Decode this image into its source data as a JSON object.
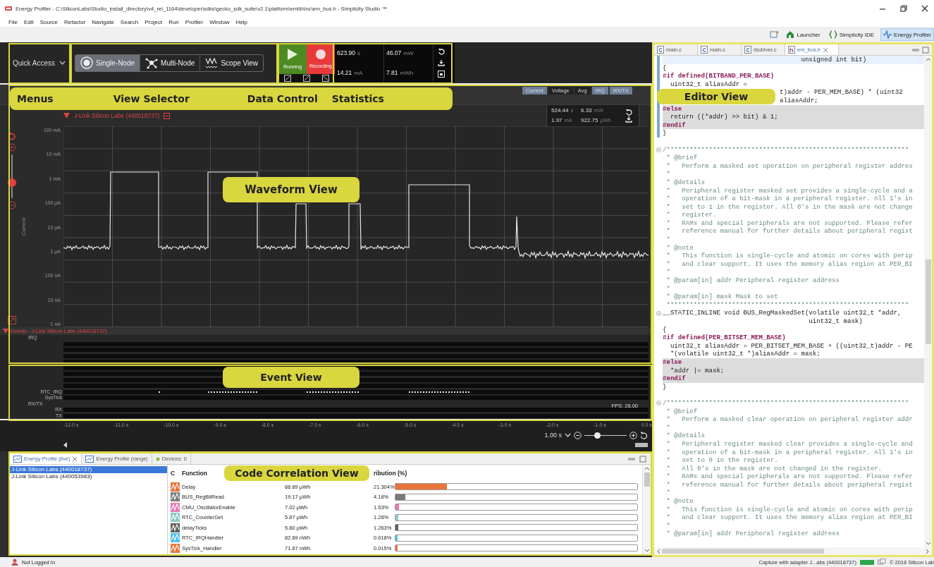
{
  "window": {
    "title": "Energy Profiler - C:\\SiliconLabs\\Studio_install_directory\\v4_rel_1164\\developer\\sdks\\gecko_sdk_suite\\v2.1\\platform\\emlib\\inc\\em_bus.h - Simplicity Studio ™"
  },
  "menu": [
    "File",
    "Edit",
    "Source",
    "Refactor",
    "Navigate",
    "Search",
    "Project",
    "Run",
    "Profiler",
    "Window",
    "Help"
  ],
  "perspectives": [
    {
      "label": "Launcher",
      "kind": "home",
      "selected": false
    },
    {
      "label": "Simplicity IDE",
      "kind": "braces",
      "selected": false
    },
    {
      "label": "Energy Profiler",
      "kind": "pulse",
      "selected": true
    }
  ],
  "toolbar": {
    "quick_access": "Quick Access",
    "views": [
      {
        "label": "Single-Node",
        "kind": "single",
        "selected": true
      },
      {
        "label": "Multi-Node",
        "kind": "multi",
        "selected": false
      },
      {
        "label": "Scope View",
        "kind": "scope",
        "selected": false
      }
    ],
    "controls": [
      {
        "label": "Running",
        "kind": "play"
      },
      {
        "label": "Recording",
        "kind": "record"
      }
    ],
    "statistics": [
      {
        "value": "623.90",
        "unit": "s"
      },
      {
        "value": "46.07",
        "unit": "mW"
      },
      {
        "value": "14.21",
        "unit": "mA"
      },
      {
        "value": "7.81",
        "unit": "mWh"
      }
    ]
  },
  "annotations": {
    "top": [
      "Menus",
      "View Selector",
      "Data Control",
      "Statistics"
    ],
    "waveform": "Waveform View",
    "events": "Event View",
    "code": "Code Correlation View",
    "editor": "Editor View"
  },
  "waveform": {
    "toggles": [
      {
        "label": "Current",
        "on": true
      },
      {
        "label": "Voltage",
        "on": false
      },
      {
        "label": "Avg",
        "on": false
      },
      {
        "label": "IRQ",
        "on": true
      },
      {
        "label": "RX/TX",
        "on": true
      }
    ],
    "device": "J-Link Silicon Labs (440018737)",
    "stats": [
      {
        "value": "524.44",
        "unit": "s"
      },
      {
        "value": "6.33",
        "unit": "mW"
      },
      {
        "value": "1.97",
        "unit": "mA"
      },
      {
        "value": "922.75",
        "unit": "µWh"
      }
    ],
    "y_axis_title": "Current",
    "y_ticks": [
      "100 mA",
      "10 mA",
      "1 mA",
      "100 µA",
      "10 µA",
      "1 µA",
      "100 nA",
      "10 nA",
      "1 nA"
    ],
    "zoom_slider": {
      "level": 0.35
    }
  },
  "events": {
    "title": "Events - J-Link Silicon Labs (440018737)",
    "rows": [
      {
        "label": "IRQ",
        "kind": "group"
      },
      {
        "kind": "track"
      },
      {
        "kind": "track"
      },
      {
        "kind": "track"
      },
      {
        "kind": "track"
      },
      {
        "kind": "track"
      },
      {
        "kind": "track"
      },
      {
        "kind": "track"
      },
      {
        "kind": "track"
      },
      {
        "label": "RTC_IRQ",
        "kind": "track"
      },
      {
        "label": "SysTick",
        "kind": "track"
      },
      {
        "label": "RX/TX",
        "kind": "group"
      },
      {
        "label": "RX",
        "kind": "track"
      },
      {
        "label": "TX",
        "kind": "track"
      }
    ],
    "fps": "FPS: 28.00"
  },
  "timeline": {
    "ticks": [
      "-12.0 s",
      "-11.0 s",
      "-10.0 s",
      "-9.0 s",
      "-8.0 s",
      "-7.0 s",
      "-6.0 s",
      "-5.0 s",
      "-4.0 s",
      "-3.0 s",
      "-2.0 s",
      "-1.0 s",
      "0.0 s"
    ],
    "zoom": "1.00 s",
    "zoom_slider": {
      "level": 0.3
    }
  },
  "bottom_panel": {
    "tabs": [
      {
        "label": "Energy Profile (live)",
        "kind": "profile",
        "selected": true
      },
      {
        "label": "Energy Profile (range)",
        "kind": "profile",
        "selected": false
      },
      {
        "label": "Devices: 0",
        "kind": "devices",
        "selected": false
      }
    ],
    "devices": [
      {
        "label": "J-Link Silicon Labs (440018737)",
        "selected": true
      },
      {
        "label": "J-Link Silicon Labs (440053983)",
        "selected": false
      }
    ],
    "table": {
      "columns": [
        "C",
        "Function",
        "ribution (%)"
      ],
      "rows": [
        {
          "function": "Delay",
          "energy": "88.89 µWh",
          "percent": "21.304%",
          "level": 0.213,
          "color": "#e8743b"
        },
        {
          "function": "BUS_RegBitRead",
          "energy": "19.17 µWh",
          "percent": "4.18%",
          "level": 0.042,
          "color": "#7a7a7a"
        },
        {
          "function": "CMU_OscillatorEnable",
          "energy": "7.02 µWh",
          "percent": "1.53%",
          "level": 0.015,
          "color": "#e67ab5"
        },
        {
          "function": "RTC_CounterGet",
          "energy": "5.87 µWh",
          "percent": "1.28%",
          "level": 0.013,
          "color": "#8cc8c8"
        },
        {
          "function": "delayTicks",
          "energy": "5.80 µWh",
          "percent": "1.263%",
          "level": 0.013,
          "color": "#5f5f5f"
        },
        {
          "function": "RTC_IRQHandler",
          "energy": "82.69 nWh",
          "percent": "0.018%",
          "level": 0.0002,
          "color": "#4cc3ea"
        },
        {
          "function": "SysTick_Handler",
          "energy": "71.67 nWh",
          "percent": "0.015%",
          "level": 0.0002,
          "color": "#e8743b"
        }
      ]
    }
  },
  "editor": {
    "tabs": [
      {
        "label": "main.c",
        "kind": "source",
        "selected": false
      },
      {
        "label": "main.c",
        "kind": "source",
        "selected": false
      },
      {
        "label": "rtcdriver.c",
        "kind": "source",
        "selected": false
      },
      {
        "label": "em_bus.h",
        "kind": "header",
        "selected": true
      }
    ],
    "lines": [
      {
        "text": "                                    unsigned int bit)",
        "kind": "code",
        "current": true
      },
      {
        "text": "{",
        "kind": "code"
      },
      {
        "text": "#if defined(BITBAND_PER_BASE)",
        "kind": "directive"
      },
      {
        "text": "  uint32_t aliasAddr =",
        "kind": "code"
      },
      {
        "text": "t)addr - PER_MEM_BASE) * (uint32",
        "kind": "covered"
      },
      {
        "text": "aliasAddr;",
        "kind": "covered"
      },
      {
        "text": "#else",
        "kind": "directive",
        "inactive": true
      },
      {
        "text": "  return ((*addr) >> bit) & 1;",
        "kind": "code",
        "inactive": true
      },
      {
        "text": "#endif",
        "kind": "directive",
        "inactive": true
      },
      {
        "text": "}",
        "kind": "code"
      },
      {
        "kind": "blank"
      },
      {
        "text": "/***************************************************************",
        "kind": "comment",
        "fold": true
      },
      {
        "text": " * @brief",
        "kind": "comment"
      },
      {
        "text": " *   Perform a masked set operation on peripheral register addres",
        "kind": "comment"
      },
      {
        "text": " *",
        "kind": "comment"
      },
      {
        "text": " * @details",
        "kind": "comment"
      },
      {
        "text": " *   Peripheral register masked set provides a single-cycle and a",
        "kind": "comment"
      },
      {
        "text": " *   operation of a bit-mask in a peripheral register. All 1's in",
        "kind": "comment"
      },
      {
        "text": " *   set to 1 in the register. All 0's in the mask are not change",
        "kind": "comment"
      },
      {
        "text": " *   register.",
        "kind": "comment"
      },
      {
        "text": " *   RAMs and special peripherals are not supported. Please refer",
        "kind": "comment"
      },
      {
        "text": " *   reference manual for further details about peripheral regist",
        "kind": "comment"
      },
      {
        "text": " *",
        "kind": "comment"
      },
      {
        "text": " * @note",
        "kind": "comment"
      },
      {
        "text": " *   This function is single-cycle and atomic on cores with perip",
        "kind": "comment"
      },
      {
        "text": " *   and clear support. It uses the memory alias region at PER_BI",
        "kind": "comment"
      },
      {
        "text": " *",
        "kind": "comment"
      },
      {
        "text": " * @param[in] addr Peripheral register address",
        "kind": "comment"
      },
      {
        "text": " *",
        "kind": "comment"
      },
      {
        "text": " * @param[in] mask Mask to set",
        "kind": "comment"
      },
      {
        "text": " ***************************************************************",
        "kind": "comment"
      },
      {
        "text": "__STATIC_INLINE void BUS_RegMaskedSet(volatile uint32_t *addr,",
        "kind": "code",
        "fold": true
      },
      {
        "text": "                                      uint32_t mask)",
        "kind": "code"
      },
      {
        "text": "{",
        "kind": "code"
      },
      {
        "text": "#if defined(PER_BITSET_MEM_BASE)",
        "kind": "directive"
      },
      {
        "text": "  uint32_t aliasAddr = PER_BITSET_MEM_BASE + ((uint32_t)addr - PE",
        "kind": "code"
      },
      {
        "text": "  *(volatile uint32_t *)aliasAddr = mask;",
        "kind": "code"
      },
      {
        "text": "#else",
        "kind": "directive",
        "inactive": true
      },
      {
        "text": "  *addr |= mask;",
        "kind": "code",
        "inactive": true
      },
      {
        "text": "#endif",
        "kind": "directive",
        "inactive": true
      },
      {
        "text": "}",
        "kind": "code"
      },
      {
        "kind": "blank"
      },
      {
        "text": "/***************************************************************",
        "kind": "comment",
        "fold": true
      },
      {
        "text": " * @brief",
        "kind": "comment"
      },
      {
        "text": " *   Perform a masked clear operation on peripheral register addr",
        "kind": "comment"
      },
      {
        "text": " *",
        "kind": "comment"
      },
      {
        "text": " * @details",
        "kind": "comment"
      },
      {
        "text": " *   Peripheral register masked clear provides a single-cycle and",
        "kind": "comment"
      },
      {
        "text": " *   operation of a bit-mask in a peripheral register. All 1's in",
        "kind": "comment"
      },
      {
        "text": " *   set to 0 in the register.",
        "kind": "comment"
      },
      {
        "text": " *   All 0's in the mask are not changed in the register.",
        "kind": "comment"
      },
      {
        "text": " *   RAMs and special peripherals are not supported. Please refer",
        "kind": "comment"
      },
      {
        "text": " *   reference manual for further details about peripheral regist",
        "kind": "comment"
      },
      {
        "text": " *",
        "kind": "comment"
      },
      {
        "text": " * @note",
        "kind": "comment"
      },
      {
        "text": " *   This function is single-cycle and atomic on cores with perip",
        "kind": "comment"
      },
      {
        "text": " *   and clear support. It uses the memory alias region at PER_BI",
        "kind": "comment"
      },
      {
        "text": " *",
        "kind": "comment"
      },
      {
        "text": " * @param[in] addr Peripheral register address",
        "kind": "comment"
      }
    ]
  },
  "status_bar": {
    "left": "Not Logged In",
    "capture": "Capture with adapter J...abs (440018737)",
    "copyright": "© 2018 Silicon Lab"
  }
}
